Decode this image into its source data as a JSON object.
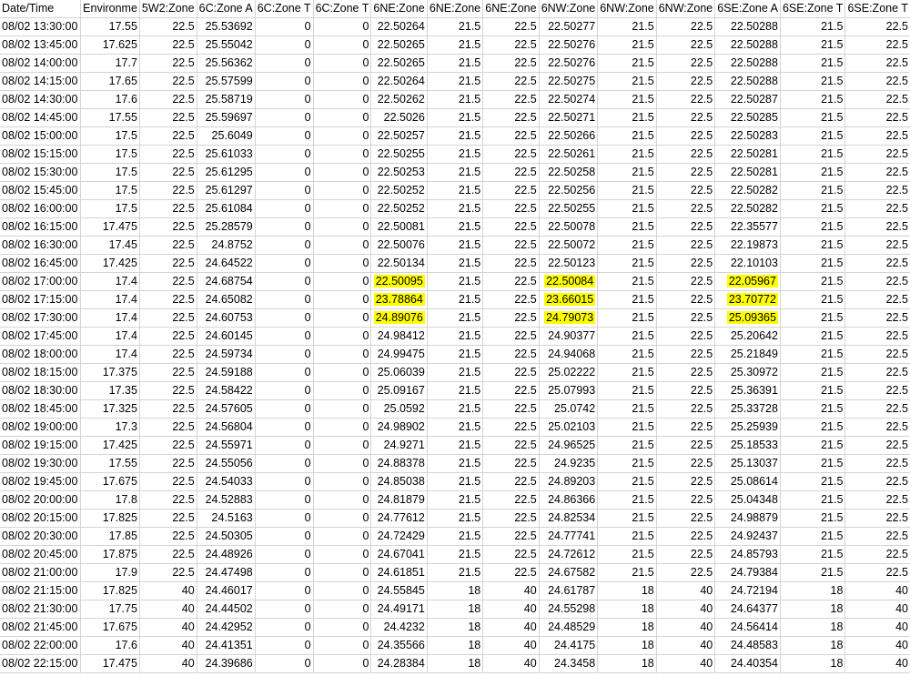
{
  "sheet": {
    "highlight_color": "#ffff00",
    "headers": [
      "Date/Time",
      "Environme",
      "5W2:Zone",
      "6C:Zone A",
      "6C:Zone T",
      "6C:Zone T",
      "6NE:Zone",
      "6NE:Zone",
      "6NE:Zone",
      "6NW:Zone",
      "6NW:Zone",
      "6NW:Zone",
      "6SE:Zone A",
      "6SE:Zone T",
      "6SE:Zone T"
    ],
    "rows": [
      [
        "08/02  13:30:00",
        "17.55",
        "22.5",
        "25.53692",
        "0",
        "0",
        "22.50264",
        "21.5",
        "22.5",
        "22.50277",
        "21.5",
        "22.5",
        "22.50288",
        "21.5",
        "22.5"
      ],
      [
        "08/02  13:45:00",
        "17.625",
        "22.5",
        "25.55042",
        "0",
        "0",
        "22.50265",
        "21.5",
        "22.5",
        "22.50276",
        "21.5",
        "22.5",
        "22.50288",
        "21.5",
        "22.5"
      ],
      [
        "08/02  14:00:00",
        "17.7",
        "22.5",
        "25.56362",
        "0",
        "0",
        "22.50265",
        "21.5",
        "22.5",
        "22.50276",
        "21.5",
        "22.5",
        "22.50288",
        "21.5",
        "22.5"
      ],
      [
        "08/02  14:15:00",
        "17.65",
        "22.5",
        "25.57599",
        "0",
        "0",
        "22.50264",
        "21.5",
        "22.5",
        "22.50275",
        "21.5",
        "22.5",
        "22.50288",
        "21.5",
        "22.5"
      ],
      [
        "08/02  14:30:00",
        "17.6",
        "22.5",
        "25.58719",
        "0",
        "0",
        "22.50262",
        "21.5",
        "22.5",
        "22.50274",
        "21.5",
        "22.5",
        "22.50287",
        "21.5",
        "22.5"
      ],
      [
        "08/02  14:45:00",
        "17.55",
        "22.5",
        "25.59697",
        "0",
        "0",
        "22.5026",
        "21.5",
        "22.5",
        "22.50271",
        "21.5",
        "22.5",
        "22.50285",
        "21.5",
        "22.5"
      ],
      [
        "08/02  15:00:00",
        "17.5",
        "22.5",
        "25.6049",
        "0",
        "0",
        "22.50257",
        "21.5",
        "22.5",
        "22.50266",
        "21.5",
        "22.5",
        "22.50283",
        "21.5",
        "22.5"
      ],
      [
        "08/02  15:15:00",
        "17.5",
        "22.5",
        "25.61033",
        "0",
        "0",
        "22.50255",
        "21.5",
        "22.5",
        "22.50261",
        "21.5",
        "22.5",
        "22.50281",
        "21.5",
        "22.5"
      ],
      [
        "08/02  15:30:00",
        "17.5",
        "22.5",
        "25.61295",
        "0",
        "0",
        "22.50253",
        "21.5",
        "22.5",
        "22.50258",
        "21.5",
        "22.5",
        "22.50281",
        "21.5",
        "22.5"
      ],
      [
        "08/02  15:45:00",
        "17.5",
        "22.5",
        "25.61297",
        "0",
        "0",
        "22.50252",
        "21.5",
        "22.5",
        "22.50256",
        "21.5",
        "22.5",
        "22.50282",
        "21.5",
        "22.5"
      ],
      [
        "08/02  16:00:00",
        "17.5",
        "22.5",
        "25.61084",
        "0",
        "0",
        "22.50252",
        "21.5",
        "22.5",
        "22.50255",
        "21.5",
        "22.5",
        "22.50282",
        "21.5",
        "22.5"
      ],
      [
        "08/02  16:15:00",
        "17.475",
        "22.5",
        "25.28579",
        "0",
        "0",
        "22.50081",
        "21.5",
        "22.5",
        "22.50078",
        "21.5",
        "22.5",
        "22.35577",
        "21.5",
        "22.5"
      ],
      [
        "08/02  16:30:00",
        "17.45",
        "22.5",
        "24.8752",
        "0",
        "0",
        "22.50076",
        "21.5",
        "22.5",
        "22.50072",
        "21.5",
        "22.5",
        "22.19873",
        "21.5",
        "22.5"
      ],
      [
        "08/02  16:45:00",
        "17.425",
        "22.5",
        "24.64522",
        "0",
        "0",
        "22.50134",
        "21.5",
        "22.5",
        "22.50123",
        "21.5",
        "22.5",
        "22.10103",
        "21.5",
        "22.5"
      ],
      [
        "08/02  17:00:00",
        "17.4",
        "22.5",
        "24.68754",
        "0",
        "0",
        "22.50095",
        "21.5",
        "22.5",
        "22.50084",
        "21.5",
        "22.5",
        "22.05967",
        "21.5",
        "22.5"
      ],
      [
        "08/02  17:15:00",
        "17.4",
        "22.5",
        "24.65082",
        "0",
        "0",
        "23.78864",
        "21.5",
        "22.5",
        "23.66015",
        "21.5",
        "22.5",
        "23.70772",
        "21.5",
        "22.5"
      ],
      [
        "08/02  17:30:00",
        "17.4",
        "22.5",
        "24.60753",
        "0",
        "0",
        "24.89076",
        "21.5",
        "22.5",
        "24.79073",
        "21.5",
        "22.5",
        "25.09365",
        "21.5",
        "22.5"
      ],
      [
        "08/02  17:45:00",
        "17.4",
        "22.5",
        "24.60145",
        "0",
        "0",
        "24.98412",
        "21.5",
        "22.5",
        "24.90377",
        "21.5",
        "22.5",
        "25.20642",
        "21.5",
        "22.5"
      ],
      [
        "08/02  18:00:00",
        "17.4",
        "22.5",
        "24.59734",
        "0",
        "0",
        "24.99475",
        "21.5",
        "22.5",
        "24.94068",
        "21.5",
        "22.5",
        "25.21849",
        "21.5",
        "22.5"
      ],
      [
        "08/02  18:15:00",
        "17.375",
        "22.5",
        "24.59188",
        "0",
        "0",
        "25.06039",
        "21.5",
        "22.5",
        "25.02222",
        "21.5",
        "22.5",
        "25.30972",
        "21.5",
        "22.5"
      ],
      [
        "08/02  18:30:00",
        "17.35",
        "22.5",
        "24.58422",
        "0",
        "0",
        "25.09167",
        "21.5",
        "22.5",
        "25.07993",
        "21.5",
        "22.5",
        "25.36391",
        "21.5",
        "22.5"
      ],
      [
        "08/02  18:45:00",
        "17.325",
        "22.5",
        "24.57605",
        "0",
        "0",
        "25.0592",
        "21.5",
        "22.5",
        "25.0742",
        "21.5",
        "22.5",
        "25.33728",
        "21.5",
        "22.5"
      ],
      [
        "08/02  19:00:00",
        "17.3",
        "22.5",
        "24.56804",
        "0",
        "0",
        "24.98902",
        "21.5",
        "22.5",
        "25.02103",
        "21.5",
        "22.5",
        "25.25939",
        "21.5",
        "22.5"
      ],
      [
        "08/02  19:15:00",
        "17.425",
        "22.5",
        "24.55971",
        "0",
        "0",
        "24.9271",
        "21.5",
        "22.5",
        "24.96525",
        "21.5",
        "22.5",
        "25.18533",
        "21.5",
        "22.5"
      ],
      [
        "08/02  19:30:00",
        "17.55",
        "22.5",
        "24.55056",
        "0",
        "0",
        "24.88378",
        "21.5",
        "22.5",
        "24.9235",
        "21.5",
        "22.5",
        "25.13037",
        "21.5",
        "22.5"
      ],
      [
        "08/02  19:45:00",
        "17.675",
        "22.5",
        "24.54033",
        "0",
        "0",
        "24.85038",
        "21.5",
        "22.5",
        "24.89203",
        "21.5",
        "22.5",
        "25.08614",
        "21.5",
        "22.5"
      ],
      [
        "08/02  20:00:00",
        "17.8",
        "22.5",
        "24.52883",
        "0",
        "0",
        "24.81879",
        "21.5",
        "22.5",
        "24.86366",
        "21.5",
        "22.5",
        "25.04348",
        "21.5",
        "22.5"
      ],
      [
        "08/02  20:15:00",
        "17.825",
        "22.5",
        "24.5163",
        "0",
        "0",
        "24.77612",
        "21.5",
        "22.5",
        "24.82534",
        "21.5",
        "22.5",
        "24.98879",
        "21.5",
        "22.5"
      ],
      [
        "08/02  20:30:00",
        "17.85",
        "22.5",
        "24.50305",
        "0",
        "0",
        "24.72429",
        "21.5",
        "22.5",
        "24.77741",
        "21.5",
        "22.5",
        "24.92437",
        "21.5",
        "22.5"
      ],
      [
        "08/02  20:45:00",
        "17.875",
        "22.5",
        "24.48926",
        "0",
        "0",
        "24.67041",
        "21.5",
        "22.5",
        "24.72612",
        "21.5",
        "22.5",
        "24.85793",
        "21.5",
        "22.5"
      ],
      [
        "08/02  21:00:00",
        "17.9",
        "22.5",
        "24.47498",
        "0",
        "0",
        "24.61851",
        "21.5",
        "22.5",
        "24.67582",
        "21.5",
        "22.5",
        "24.79384",
        "21.5",
        "22.5"
      ],
      [
        "08/02  21:15:00",
        "17.825",
        "40",
        "24.46017",
        "0",
        "0",
        "24.55845",
        "18",
        "40",
        "24.61787",
        "18",
        "40",
        "24.72194",
        "18",
        "40"
      ],
      [
        "08/02  21:30:00",
        "17.75",
        "40",
        "24.44502",
        "0",
        "0",
        "24.49171",
        "18",
        "40",
        "24.55298",
        "18",
        "40",
        "24.64377",
        "18",
        "40"
      ],
      [
        "08/02  21:45:00",
        "17.675",
        "40",
        "24.42952",
        "0",
        "0",
        "24.4232",
        "18",
        "40",
        "24.48529",
        "18",
        "40",
        "24.56414",
        "18",
        "40"
      ],
      [
        "08/02  22:00:00",
        "17.6",
        "40",
        "24.41351",
        "0",
        "0",
        "24.35566",
        "18",
        "40",
        "24.4175",
        "18",
        "40",
        "24.48583",
        "18",
        "40"
      ],
      [
        "08/02  22:15:00",
        "17.475",
        "40",
        "24.39686",
        "0",
        "0",
        "24.28384",
        "18",
        "40",
        "24.3458",
        "18",
        "40",
        "24.40354",
        "18",
        "40"
      ]
    ],
    "highlighted_cells": [
      [
        14,
        6
      ],
      [
        14,
        9
      ],
      [
        14,
        12
      ],
      [
        15,
        6
      ],
      [
        15,
        9
      ],
      [
        15,
        12
      ],
      [
        16,
        6
      ],
      [
        16,
        9
      ],
      [
        16,
        12
      ]
    ]
  }
}
